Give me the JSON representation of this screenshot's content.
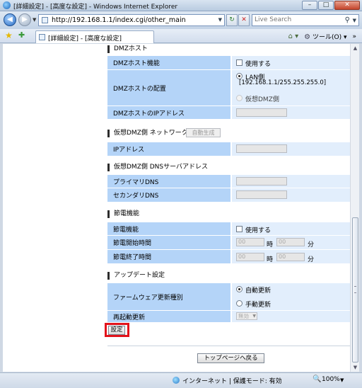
{
  "window": {
    "title": "[詳細設定] - [高度な設定] - Windows Internet Explorer",
    "minimize": "–",
    "maximize": "□",
    "close": "✕"
  },
  "address": {
    "url": "http://192.168.1.1/index.cgi/other_main",
    "search_placeholder": "Live Search"
  },
  "tab": {
    "label": "[詳細設定] - [高度な設定]"
  },
  "commands": {
    "tools_label": "ツール(O)"
  },
  "icons": {
    "back": "back-arrow-icon",
    "forward": "forward-arrow-icon",
    "refresh": "refresh-icon",
    "stop": "stop-icon",
    "search": "search-icon",
    "favorites": "star-icon",
    "add_favorites": "add-favorite-icon",
    "home": "home-icon",
    "tools": "gear-icon",
    "zone": "globe-icon",
    "zoom": "magnifier-icon"
  },
  "colors": {
    "label_cell": "#b4d4f8",
    "value_cell": "#e2eefc",
    "highlight_border": "#e2131b"
  },
  "dmz": {
    "heading": "DMZホスト",
    "function_label": "DMZホスト機能",
    "use_label": "使用する",
    "use_checked": false,
    "placement_label": "DMZホストの配置",
    "lan_option": "LAN側",
    "lan_detail": "[192.168.1.1/255.255.255.0]",
    "lan_selected": true,
    "virtual_option": "仮想DMZ側",
    "virtual_selected": false,
    "ip_label": "DMZホストのIPアドレス",
    "ip_value": ""
  },
  "vdmz_network": {
    "heading": "仮想DMZ側 ネットワーク",
    "auto_button": "自動生成",
    "ip_label": "IPアドレス",
    "ip_value": ""
  },
  "vdmz_dns": {
    "heading": "仮想DMZ側 DNSサーバアドレス",
    "primary_label": "プライマリDNS",
    "primary_value": "",
    "secondary_label": "セカンダリDNS",
    "secondary_value": ""
  },
  "power": {
    "heading": "節電機能",
    "function_label": "節電機能",
    "use_label": "使用する",
    "use_checked": false,
    "start_label": "節電開始時間",
    "end_label": "節電終了時間",
    "hour_placeholder": "00",
    "minute_placeholder": "00",
    "hour_unit": "時",
    "minute_unit": "分"
  },
  "update": {
    "heading": "アップデート設定",
    "type_label": "ファームウェア更新種別",
    "auto_option": "自動更新",
    "auto_selected": true,
    "manual_option": "手動更新",
    "manual_selected": false,
    "reboot_label": "再起動更新",
    "reboot_value": "無効"
  },
  "actions": {
    "set_button": "設定",
    "top_button": "トップページへ戻る"
  },
  "status": {
    "zone_text": "インターネット | 保護モード: 有効",
    "zoom": "100%"
  }
}
